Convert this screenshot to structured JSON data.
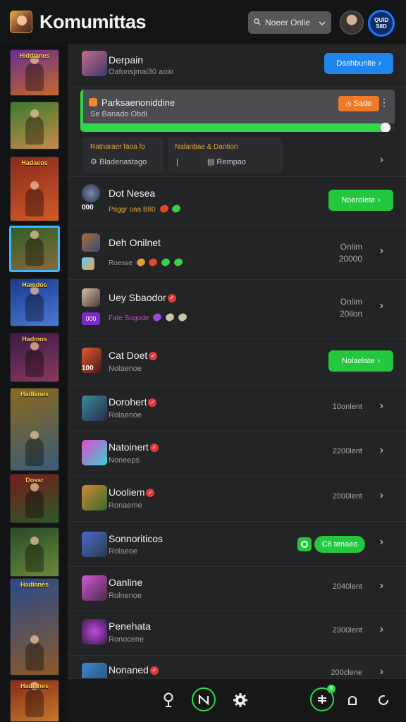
{
  "header": {
    "title": "Komumittas",
    "status_select": "Noeer Onlie",
    "qr_label": "QUID\nSIID"
  },
  "game_rail": {
    "items": [
      {
        "label": "Hiddlanes",
        "colors": [
          "#6a2c8f",
          "#c46a2a"
        ]
      },
      {
        "label": "",
        "colors": [
          "#3c7a2e",
          "#c98a4a"
        ]
      },
      {
        "label": "Hadaeos",
        "colors": [
          "#8a2a1a",
          "#d25a2a"
        ]
      },
      {
        "label": "",
        "colors": [
          "#2f5f2a",
          "#8a6a3a"
        ],
        "selected": true
      },
      {
        "label": "Hamdos",
        "colors": [
          "#1a3a8a",
          "#4a7ad8"
        ]
      },
      {
        "label": "Hadmos",
        "colors": [
          "#3a1a4a",
          "#8a3a5a"
        ]
      },
      {
        "label": "Hadlanes",
        "colors": [
          "#8a6a1a",
          "#3a5a7a"
        ]
      },
      {
        "label": "Dossr",
        "colors": [
          "#7a1a1a",
          "#2a5a2a"
        ]
      },
      {
        "label": "",
        "colors": [
          "#2a4a2a",
          "#6a8a3a"
        ]
      },
      {
        "label": "Hadlanes",
        "colors": [
          "#2a4a8a",
          "#8a5a2a"
        ]
      },
      {
        "label": "Hadlanes",
        "colors": [
          "#8a2a1a",
          "#c47a2a"
        ]
      }
    ]
  },
  "rows": {
    "r0": {
      "name": "Derpain",
      "sub": "Oafonsjmai30 aoio",
      "button": "Dashbunite"
    },
    "progress": {
      "title": "Parksaenoniddine",
      "sub": "Se Banado Obdi",
      "badge": "Sado",
      "percent": 97
    },
    "sub_a": {
      "top": "Ratnaraer faoa fo",
      "bottom": "Bladenastago"
    },
    "sub_b": {
      "top": "Nalanbae & Dantion",
      "bottom": "Rempao"
    },
    "r1": {
      "name": "Dot Nesea",
      "sub": "Paggr oaa B80",
      "badge": "000",
      "button": "Noerolete"
    },
    "r2": {
      "name": "Deh Onilnet",
      "sub": "Roesse",
      "status1": "Onlim",
      "status2": "20000"
    },
    "r3": {
      "name": "Uey Sbaodor",
      "sub": "Fate Sogode",
      "badge": "000",
      "status1": "Onlim",
      "status2": "20ilon"
    },
    "r4": {
      "name": "Cat Doet",
      "sub": "Nolaenoe",
      "badge": "100",
      "button": "Nolaelate"
    },
    "r5": {
      "name": "Dorohert",
      "sub": "Rolaenoe",
      "status1": "10onlent"
    },
    "r6": {
      "name": "Natoinert",
      "sub": "Noneeps",
      "status1": "2200lent"
    },
    "r7": {
      "name": "Uooliem",
      "sub": "Ronaeme",
      "status1": "2000lent"
    },
    "r8": {
      "name": "Sonnoriticos",
      "sub": "Rolaeoe",
      "button": "C8 tenaeo"
    },
    "r9": {
      "name": "Oanline",
      "sub": "Rolnenoe",
      "status1": "2040lent"
    },
    "r10": {
      "name": "Penehata",
      "sub": "Ronocene",
      "status1": "2300lent"
    },
    "r11": {
      "name": "Nonaned",
      "sub": "",
      "status1": "200clene"
    }
  },
  "bottom_nav": {
    "badge": "8"
  }
}
